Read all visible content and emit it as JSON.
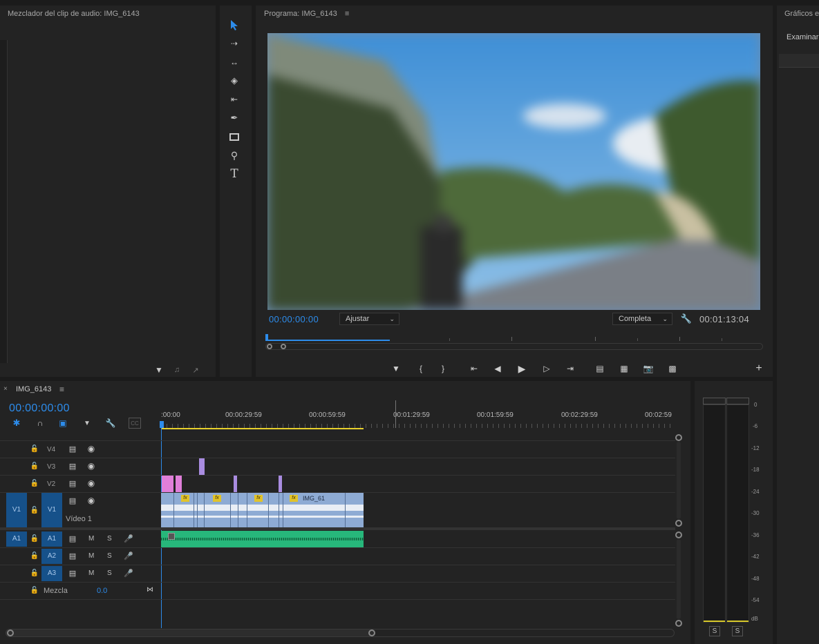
{
  "audio_mixer": {
    "title": "Mezclador del clip de audio: IMG_6143"
  },
  "tools": [
    "selection-tool",
    "track-select-forward-tool",
    "ripple-edit-tool",
    "razor-tool",
    "slip-tool",
    "pen-tool",
    "rectangle-tool",
    "zoom-tool",
    "type-tool"
  ],
  "program": {
    "title": "Programa: IMG_6143",
    "timecode_in": "00:00:00:00",
    "fit_label": "Ajustar",
    "resolution_label": "Completa",
    "duration": "00:01:13:04"
  },
  "graphics": {
    "title": "Gráficos e",
    "tab": "Examinar"
  },
  "timeline": {
    "tab_name": "IMG_6143",
    "timecode": "00:00:00:00",
    "ruler": [
      ":00:00",
      "00:00:29:59",
      "00:00:59:59",
      "00:01:29:59",
      "00:01:59:59",
      "00:02:29:59",
      "00:02:59"
    ],
    "tracks": {
      "v4": "V4",
      "v3": "V3",
      "v2": "V2",
      "v1_src": "V1",
      "v1": "V1",
      "v1_name": "Vídeo 1",
      "a1_src": "A1",
      "a1": "A1",
      "a2": "A2",
      "a3": "A3",
      "m": "M",
      "s": "S",
      "mix_label": "Mezcla",
      "mix_value": "0.0"
    },
    "clip_label": "IMG_61",
    "fx": "fx"
  },
  "meters": {
    "ticks": [
      "0",
      "-6",
      "-12",
      "-18",
      "-24",
      "-30",
      "-36",
      "-42",
      "-48",
      "-54",
      "dB"
    ],
    "solo_left": "S",
    "solo_right": "S"
  }
}
